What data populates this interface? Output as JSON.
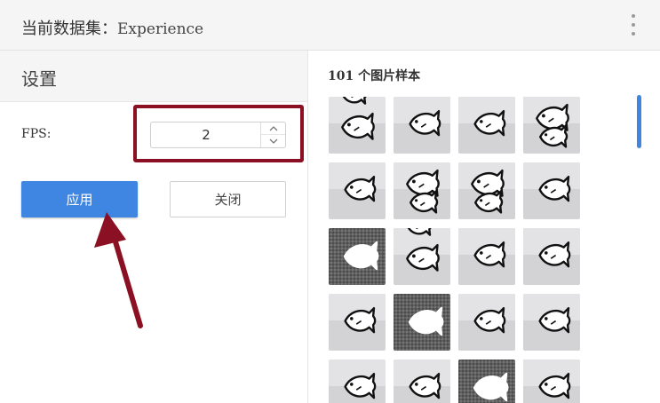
{
  "header": {
    "title_prefix": "当前数据集：",
    "dataset_name": "Experience",
    "menu_icon": "more-vert-icon"
  },
  "settings": {
    "title": "设置",
    "fps_label": "FPS:",
    "fps_value": "2",
    "apply_label": "应用",
    "close_label": "关闭",
    "accent_color": "#3f85e2",
    "annotation_color": "#8b1024"
  },
  "samples": {
    "title": "101 个图片样本",
    "images": [
      {
        "variant": "gray-fish-top"
      },
      {
        "variant": "gray-fish"
      },
      {
        "variant": "gray-fish"
      },
      {
        "variant": "gray-fish-double"
      },
      {
        "variant": "gray-fish"
      },
      {
        "variant": "gray-fish-double"
      },
      {
        "variant": "gray-fish-double"
      },
      {
        "variant": "gray-fish"
      },
      {
        "variant": "dark-fish"
      },
      {
        "variant": "gray-fish-top"
      },
      {
        "variant": "gray-fish"
      },
      {
        "variant": "gray-fish"
      },
      {
        "variant": "gray-fish"
      },
      {
        "variant": "dark-fish"
      },
      {
        "variant": "gray-fish"
      },
      {
        "variant": "gray-fish"
      },
      {
        "variant": "gray-fish"
      },
      {
        "variant": "gray-fish"
      },
      {
        "variant": "dark-fish"
      },
      {
        "variant": "gray-fish"
      }
    ]
  }
}
